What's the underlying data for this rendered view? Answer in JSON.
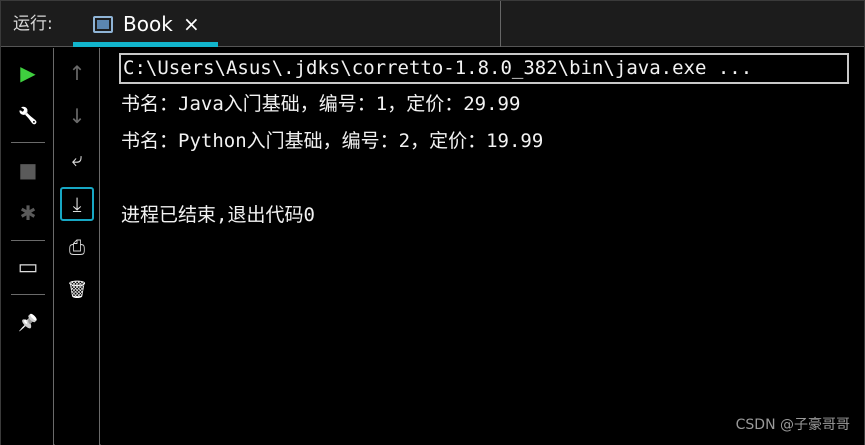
{
  "header": {
    "run_label": "运行:",
    "tab": {
      "title": "Book",
      "close_glyph": "×",
      "accent_color": "#12b5cc",
      "icon": "window-icon"
    }
  },
  "toolbar_left": [
    {
      "name": "run-icon",
      "glyph": "▶",
      "color": "#3fcf3f",
      "enabled": true
    },
    {
      "name": "wrench-icon",
      "glyph": "🔧",
      "color": "#dcdcdc",
      "enabled": true
    },
    {
      "name": "stop-icon",
      "glyph": "■",
      "color": "#5a5a5a",
      "enabled": false
    },
    {
      "name": "debug-bug-icon",
      "glyph": "✱",
      "color": "#5a5a5a",
      "enabled": false
    },
    {
      "name": "layout-icon",
      "glyph": "▭",
      "color": "#dcdcdc",
      "enabled": true
    },
    {
      "name": "pin-icon",
      "glyph": "📌",
      "color": "#dcdcdc",
      "enabled": true
    }
  ],
  "toolbar_right": [
    {
      "name": "arrow-up-icon",
      "glyph": "↑",
      "color": "#6a6a6a",
      "enabled": false
    },
    {
      "name": "arrow-down-icon",
      "glyph": "↓",
      "color": "#6a6a6a",
      "enabled": false
    },
    {
      "name": "soft-wrap-icon",
      "glyph": "⤶",
      "color": "#dcdcdc",
      "enabled": true
    },
    {
      "name": "scroll-to-end-icon",
      "glyph": "⤓",
      "color": "#dcdcdc",
      "enabled": true,
      "selected": true
    },
    {
      "name": "print-icon",
      "glyph": "⎙",
      "color": "#dcdcdc",
      "enabled": true
    },
    {
      "name": "trash-icon",
      "glyph": "🗑",
      "color": "#dcdcdc",
      "enabled": true
    }
  ],
  "console": {
    "command": "C:\\Users\\Asus\\.jdks\\corretto-1.8.0_382\\bin\\java.exe ...",
    "lines": [
      "书名：Java入门基础，编号：1，定价：29.99",
      "书名：Python入门基础，编号：2，定价：19.99",
      "",
      "进程已结束,退出代码0"
    ]
  },
  "watermark": "CSDN @子豪哥哥"
}
